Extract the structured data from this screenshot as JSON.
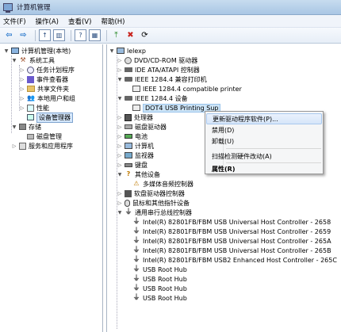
{
  "window": {
    "title": "计算机管理"
  },
  "menu": [
    "文件(F)",
    "操作(A)",
    "查看(V)",
    "帮助(H)"
  ],
  "toolbar": {
    "back": "⇦",
    "forward": "⇨",
    "up": "↑",
    "show": "▥",
    "help": "?",
    "view": "▦",
    "update": "⤒",
    "uninstall": "✖",
    "scan": "⟳"
  },
  "left_tree": {
    "root": "计算机管理(本地)",
    "system_tools": "系统工具",
    "task_scheduler": "任务计划程序",
    "event_viewer": "事件查看器",
    "shared_folders": "共享文件夹",
    "local_users": "本地用户和组",
    "performance": "性能",
    "device_manager": "设备管理器",
    "storage": "存储",
    "disk_management": "磁盘管理",
    "services_apps": "服务和应用程序"
  },
  "device_tree": {
    "root": "lelexp",
    "dvd": "DVD/CD-ROM 驱动器",
    "ide": "IDE ATA/ATAPI 控制器",
    "ieee_printer": "IEEE 1284.4 兼容打印机",
    "ieee_compat": "IEEE 1284.4 compatible printer",
    "ieee_devices": "IEEE 1284.4 设备",
    "dot4": "DOT4 USB Printing Sup",
    "processor": "处理器",
    "disk_drives": "磁盘驱动器",
    "battery": "电池",
    "computer": "计算机",
    "monitor": "监视器",
    "keyboard": "键盘",
    "other_devices": "其他设备",
    "mm_audio": "多媒体音频控制器",
    "floppy": "软盘驱动器控制器",
    "mouse": "鼠标和其他指针设备",
    "usb_controllers": "通用串行总线控制器",
    "usb_items": [
      "Intel(R) 82801FB/FBM USB Universal Host Controller - 2658",
      "Intel(R) 82801FB/FBM USB Universal Host Controller - 2659",
      "Intel(R) 82801FB/FBM USB Universal Host Controller - 265A",
      "Intel(R) 82801FB/FBM USB Universal Host Controller - 265B",
      "Intel(R) 82801FB/FBM USB2 Enhanced Host Controller - 265C",
      "USB Root Hub",
      "USB Root Hub",
      "USB Root Hub",
      "USB Root Hub"
    ]
  },
  "context_menu": {
    "update_driver": "更新驱动程序软件(P)...",
    "disable": "禁用(D)",
    "uninstall": "卸载(U)",
    "scan": "扫描检测硬件改动(A)",
    "properties": "属性(R)"
  }
}
